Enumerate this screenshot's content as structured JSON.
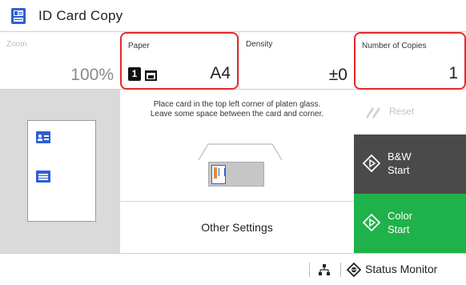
{
  "header": {
    "title": "ID Card Copy",
    "icon": "id-card-copy-icon"
  },
  "settings": {
    "zoom": {
      "label": "Zoom",
      "value": "100%"
    },
    "paper": {
      "label": "Paper",
      "tray": "1",
      "size": "A4"
    },
    "density": {
      "label": "Density",
      "value": "±0"
    },
    "copies": {
      "label": "Number of Copies",
      "value": "1"
    }
  },
  "instructions": {
    "line1": "Place card in the top left corner of platen glass.",
    "line2": "Leave some space between the card and corner."
  },
  "other_settings": {
    "label": "Other Settings"
  },
  "buttons": {
    "reset": {
      "label": "Reset",
      "enabled": false
    },
    "bw": {
      "line1": "B&W",
      "line2": "Start"
    },
    "color": {
      "line1": "Color",
      "line2": "Start"
    }
  },
  "status": {
    "monitor_label": "Status Monitor"
  },
  "colors": {
    "highlight": "#e52a2a",
    "bw_button": "#4a4a4a",
    "color_button": "#1fb24a",
    "card_blue": "#2d5fd6"
  }
}
